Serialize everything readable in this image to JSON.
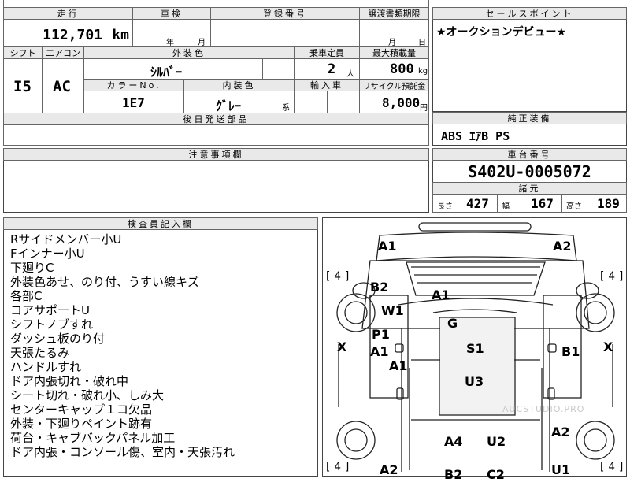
{
  "top": {
    "mileage_header": "走行",
    "mileage_value": "112,701",
    "mileage_unit": "km",
    "inspection_header": "車検",
    "inspection_year": "年",
    "inspection_month": "月",
    "registration_header": "登録番号",
    "transfer_header": "譲渡書類期限",
    "transfer_month": "月",
    "transfer_day": "日",
    "shift_header": "シフト",
    "ac_header": "エアコン",
    "exterior_color_header": "外装色",
    "capacity_header": "乗車定員",
    "max_load_header": "最大積載量",
    "shift_value": "I5",
    "ac_value": "AC",
    "exterior_color_value": "ｼﾙﾊﾞｰ",
    "capacity_value": "2",
    "capacity_unit": "人",
    "max_load_value": "800",
    "max_load_unit": "kg",
    "color_no_header": "カラーNo.",
    "interior_color_header": "内装色",
    "import_header": "輸入車",
    "recycle_header": "リサイクル預託金",
    "color_no_value": "1E7",
    "interior_color_value": "ｸﾞﾚｰ",
    "interior_color_suffix": "系",
    "recycle_value": "8,000",
    "recycle_unit": "円",
    "later_parts_header": "後日発送部品"
  },
  "sales": {
    "header": "セールスポイント",
    "text": "★オークションデビュー★"
  },
  "genuine": {
    "header": "純正装備",
    "text": "ABS ｴｱB PS"
  },
  "caution": {
    "header": "注意事項欄"
  },
  "chassis": {
    "header": "車台番号",
    "value": "S402U-0005072",
    "spec_header": "諸元",
    "length_label": "長さ",
    "length_value": "427",
    "width_label": "幅",
    "width_value": "167",
    "height_label": "高さ",
    "height_value": "189"
  },
  "inspector": {
    "header": "検査員記入欄",
    "lines": [
      "Rサイドメンバー小U",
      "Fインナー小U",
      "下廻りC",
      "外装色あせ、のり付、うすい線キズ",
      "各部C",
      "コアサポートU",
      "シフトノブすれ",
      "ダッシュ板のり付",
      "天張たるみ",
      "ハンドルすれ",
      "ドア内張切れ・破れ中",
      "シート切れ・破れ小、しみ大",
      "センターキャップ１コ欠品",
      "外装・下廻りペイント跡有",
      "荷台・キャブバックパネル加工",
      "ドア内張・コンソール傷、室内・天張汚れ"
    ]
  },
  "map": {
    "watermark": "AUCSTUDIO.PRO",
    "tire_fl": "4",
    "tire_fr": "4",
    "tire_rl": "4",
    "tire_rr": "4",
    "labels": {
      "a1_tl": "A1",
      "a2_tr": "A2",
      "b2": "B2",
      "a1_hood": "A1",
      "w1": "W1",
      "g": "G",
      "p1": "P1",
      "a1_left": "A1",
      "x_left": "X",
      "s1": "S1",
      "b1": "B1",
      "x_right": "X",
      "a1_low": "A1",
      "u3": "U3",
      "a2_right": "A2",
      "a4": "A4",
      "u2": "U2",
      "a2_bottom": "A2",
      "b2_bottom": "B2",
      "c2_bottom": "C2",
      "u1_bottom": "U1"
    }
  }
}
